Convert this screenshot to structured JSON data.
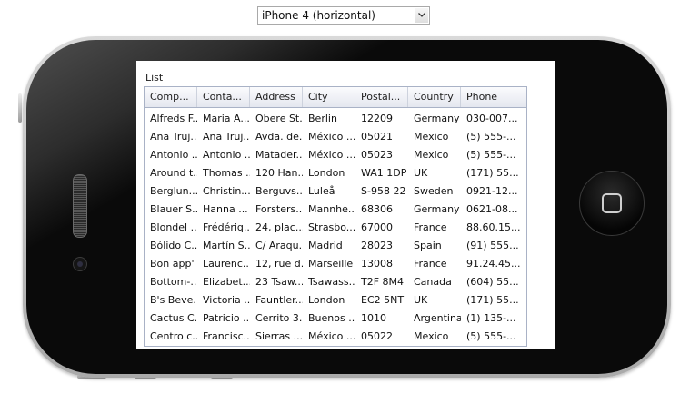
{
  "device_selector": {
    "selected": "iPhone 4 (horizontal)"
  },
  "screen": {
    "title": "List",
    "columns": [
      "Comp...",
      "Conta...",
      "Address",
      "City",
      "Postal...",
      "Country",
      "Phone"
    ],
    "rows": [
      [
        "Alfreds F...",
        "Maria A...",
        "Obere St...",
        "Berlin",
        "12209",
        "Germany",
        "030-007..."
      ],
      [
        "Ana Truj...",
        "Ana Truj...",
        "Avda. de...",
        "México ...",
        "05021",
        "Mexico",
        "(5) 555-..."
      ],
      [
        "Antonio ...",
        "Antonio ...",
        "Matader...",
        "México ...",
        "05023",
        "Mexico",
        "(5) 555-..."
      ],
      [
        "Around t...",
        "Thomas ...",
        "120 Han...",
        "London",
        "WA1 1DP",
        "UK",
        "(171) 55..."
      ],
      [
        "Berglun...",
        "Christin...",
        "Berguvs...",
        "Luleå",
        "S-958 22",
        "Sweden",
        "0921-12..."
      ],
      [
        "Blauer S...",
        "Hanna ...",
        "Forsters...",
        "Mannhe...",
        "68306",
        "Germany",
        "0621-08..."
      ],
      [
        "Blondel ...",
        "Frédériq...",
        "24, plac...",
        "Strasbo...",
        "67000",
        "France",
        "88.60.15..."
      ],
      [
        "Bólido C...",
        "Martín S...",
        "C/ Araqu...",
        "Madrid",
        "28023",
        "Spain",
        "(91) 555..."
      ],
      [
        "Bon app'",
        "Laurenc...",
        "12, rue d...",
        "Marseille",
        "13008",
        "France",
        "91.24.45..."
      ],
      [
        "Bottom-...",
        "Elizabet...",
        "23 Tsaw...",
        "Tsawass...",
        "T2F 8M4",
        "Canada",
        "(604) 55..."
      ],
      [
        "B's Beve...",
        "Victoria ...",
        "Fauntler...",
        "London",
        "EC2 5NT",
        "UK",
        "(171) 55..."
      ],
      [
        "Cactus C...",
        "Patricio ...",
        "Cerrito 3...",
        "Buenos ...",
        "1010",
        "Argentina",
        "(1) 135-..."
      ],
      [
        "Centro c...",
        "Francisc...",
        "Sierras ...",
        "México ...",
        "05022",
        "Mexico",
        "(5) 555-..."
      ]
    ]
  }
}
